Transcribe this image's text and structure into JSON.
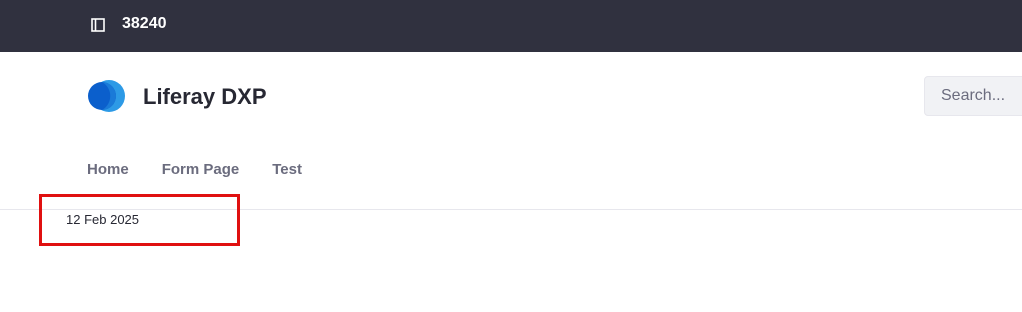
{
  "topbar": {
    "site_id": "38240",
    "toggle_icon": "sidebar-panel-icon"
  },
  "header": {
    "site_name": "Liferay DXP",
    "logo_icon": "liferay-logo",
    "search": {
      "placeholder": "Search..."
    }
  },
  "nav": {
    "items": [
      {
        "label": "Home"
      },
      {
        "label": "Form Page"
      },
      {
        "label": "Test"
      }
    ]
  },
  "content": {
    "date": "12 Feb 2025"
  },
  "colors": {
    "topbar_bg": "#30313f",
    "highlight": "#e01010",
    "logo_dark": "#0b5fcc",
    "logo_light": "#2d9ae6"
  }
}
